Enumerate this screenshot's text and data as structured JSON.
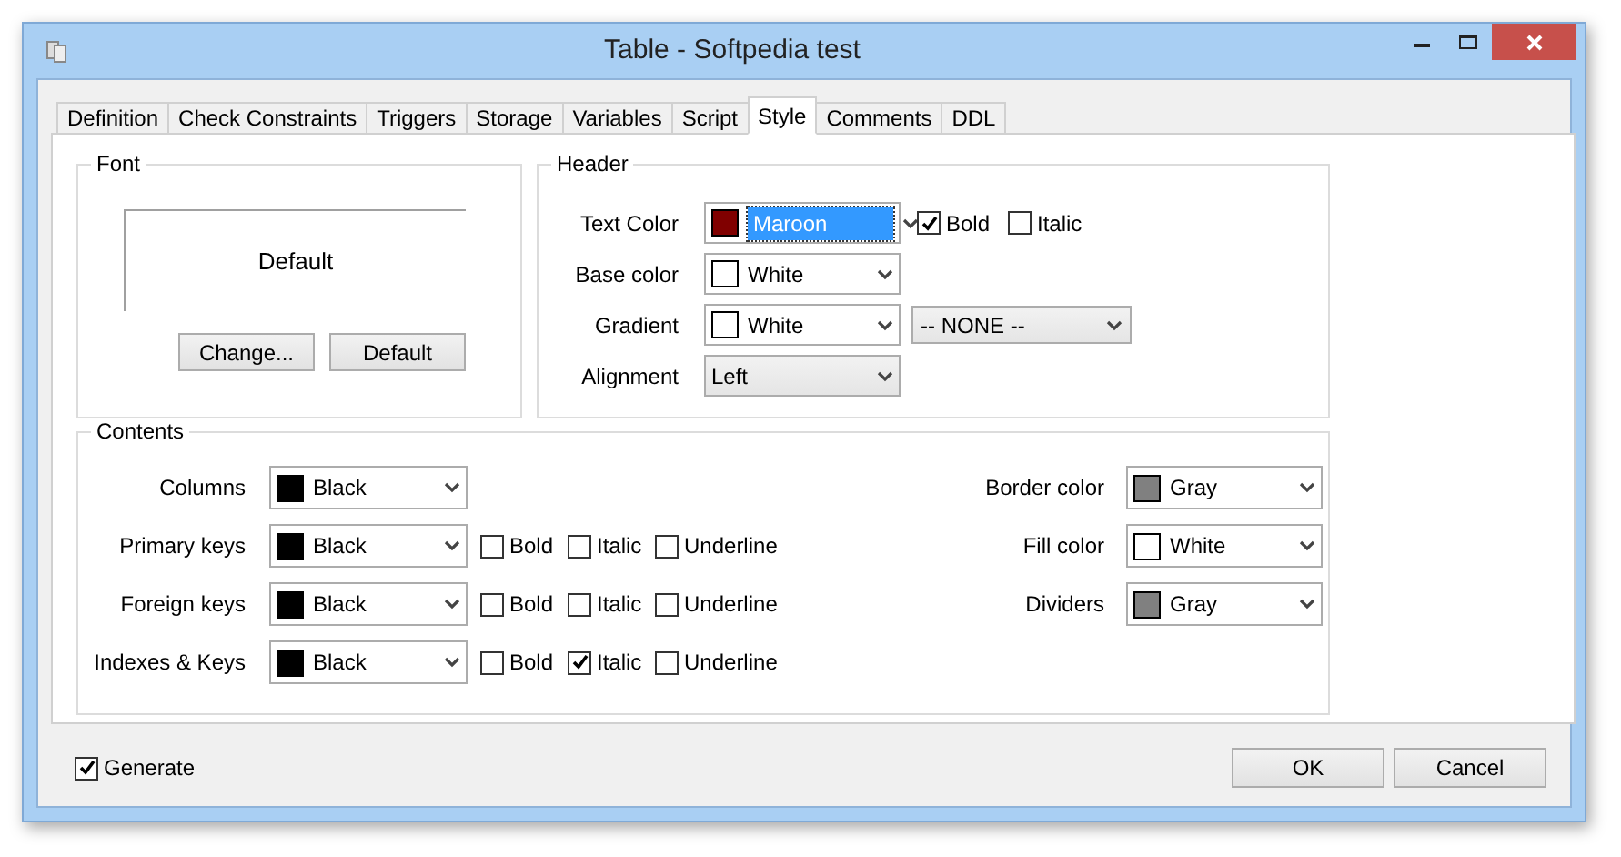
{
  "window": {
    "title": "Table - Softpedia test"
  },
  "tabs": [
    {
      "label": "Definition",
      "selected": false
    },
    {
      "label": "Check Constraints",
      "selected": false
    },
    {
      "label": "Triggers",
      "selected": false
    },
    {
      "label": "Storage",
      "selected": false
    },
    {
      "label": "Variables",
      "selected": false
    },
    {
      "label": "Script",
      "selected": false
    },
    {
      "label": "Style",
      "selected": true
    },
    {
      "label": "Comments",
      "selected": false
    },
    {
      "label": "DDL",
      "selected": false
    }
  ],
  "font_group": {
    "title": "Font",
    "preview": "Default",
    "buttons": [
      "Change...",
      "Default"
    ]
  },
  "header_group": {
    "title": "Header",
    "rows": [
      {
        "label": "Text Color",
        "kind": "color",
        "value": "Maroon",
        "color": "#800000",
        "focused": true,
        "options": [
          {
            "label": "Bold",
            "checked": true
          },
          {
            "label": "Italic",
            "checked": false
          }
        ]
      },
      {
        "label": "Base color",
        "kind": "color",
        "value": "White",
        "color": "#ffffff",
        "focused": false
      },
      {
        "label": "Gradient",
        "kind": "color",
        "value": "White",
        "color": "#ffffff",
        "focused": false,
        "extra": "-- NONE --"
      },
      {
        "label": "Alignment",
        "kind": "plain",
        "value": "Left",
        "focused": false
      }
    ]
  },
  "contents_group": {
    "title": "Contents",
    "left_rows": [
      {
        "label": "Columns",
        "value": "Black",
        "color": "#000000"
      },
      {
        "label": "Primary keys",
        "value": "Black",
        "color": "#000000",
        "options": [
          {
            "label": "Bold",
            "checked": false
          },
          {
            "label": "Italic",
            "checked": false
          },
          {
            "label": "Underline",
            "checked": false
          }
        ]
      },
      {
        "label": "Foreign keys",
        "value": "Black",
        "color": "#000000",
        "options": [
          {
            "label": "Bold",
            "checked": false
          },
          {
            "label": "Italic",
            "checked": false
          },
          {
            "label": "Underline",
            "checked": false
          }
        ]
      },
      {
        "label": "Indexes & Keys",
        "value": "Black",
        "color": "#000000",
        "options": [
          {
            "label": "Bold",
            "checked": false
          },
          {
            "label": "Italic",
            "checked": true
          },
          {
            "label": "Underline",
            "checked": false
          }
        ]
      }
    ],
    "right_rows": [
      {
        "label": "Border color",
        "value": "Gray",
        "color": "#808080"
      },
      {
        "label": "Fill color",
        "value": "White",
        "color": "#ffffff"
      },
      {
        "label": "Dividers",
        "value": "Gray",
        "color": "#808080"
      }
    ]
  },
  "generate": {
    "label": "Generate",
    "checked": true
  },
  "buttons": [
    "OK",
    "Cancel"
  ]
}
